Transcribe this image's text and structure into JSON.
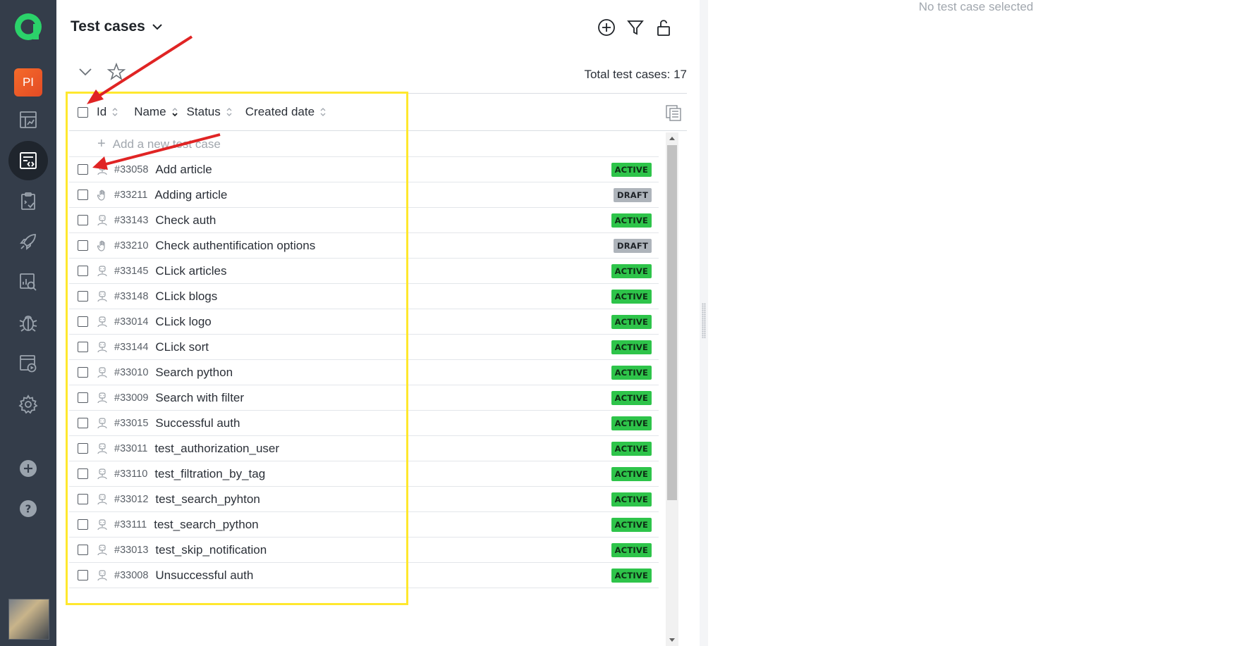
{
  "sidebar": {
    "project_initials": "PI",
    "items": [
      {
        "name": "dashboards",
        "icon": "dashboard-icon"
      },
      {
        "name": "test-cases",
        "icon": "test-cases-icon",
        "active": true
      },
      {
        "name": "test-plans",
        "icon": "test-plan-icon"
      },
      {
        "name": "launches",
        "icon": "rocket-icon"
      },
      {
        "name": "analytics",
        "icon": "analytics-search-icon"
      },
      {
        "name": "defects",
        "icon": "bug-icon"
      },
      {
        "name": "jobs",
        "icon": "jobs-icon"
      },
      {
        "name": "settings",
        "icon": "gear-icon"
      }
    ]
  },
  "header": {
    "title": "Test cases",
    "total_label": "Total test cases: 17"
  },
  "columns": [
    "Id",
    "Name",
    "Status",
    "Created date"
  ],
  "add_placeholder": "Add a new test case",
  "test_cases": [
    {
      "id": "#33058",
      "name": "Add article",
      "type": "automated",
      "status": "ACTIVE"
    },
    {
      "id": "#33211",
      "name": "Adding article",
      "type": "manual",
      "status": "DRAFT"
    },
    {
      "id": "#33143",
      "name": "Check auth",
      "type": "automated",
      "status": "ACTIVE"
    },
    {
      "id": "#33210",
      "name": "Check authentification options",
      "type": "manual",
      "status": "DRAFT"
    },
    {
      "id": "#33145",
      "name": "CLick articles",
      "type": "automated",
      "status": "ACTIVE"
    },
    {
      "id": "#33148",
      "name": "CLick blogs",
      "type": "automated",
      "status": "ACTIVE"
    },
    {
      "id": "#33014",
      "name": "CLick logo",
      "type": "automated",
      "status": "ACTIVE"
    },
    {
      "id": "#33144",
      "name": "CLick sort",
      "type": "automated",
      "status": "ACTIVE"
    },
    {
      "id": "#33010",
      "name": "Search python",
      "type": "automated",
      "status": "ACTIVE"
    },
    {
      "id": "#33009",
      "name": "Search with filter",
      "type": "automated",
      "status": "ACTIVE"
    },
    {
      "id": "#33015",
      "name": "Successful auth",
      "type": "automated",
      "status": "ACTIVE"
    },
    {
      "id": "#33011",
      "name": "test_authorization_user",
      "type": "automated",
      "status": "ACTIVE"
    },
    {
      "id": "#33110",
      "name": "test_filtration_by_tag",
      "type": "automated",
      "status": "ACTIVE"
    },
    {
      "id": "#33012",
      "name": "test_search_pyhton",
      "type": "automated",
      "status": "ACTIVE"
    },
    {
      "id": "#33111",
      "name": "test_search_python",
      "type": "automated",
      "status": "ACTIVE"
    },
    {
      "id": "#33013",
      "name": "test_skip_notification",
      "type": "automated",
      "status": "ACTIVE"
    },
    {
      "id": "#33008",
      "name": "Unsuccessful auth",
      "type": "automated",
      "status": "ACTIVE"
    }
  ],
  "detail": {
    "empty_message": "No test case selected"
  },
  "colors": {
    "sidebar_bg": "#343d4a",
    "active_badge": "#2ec44a",
    "draft_badge": "#aeb4bb",
    "highlight": "#ffe82e",
    "arrow": "#e02424"
  }
}
